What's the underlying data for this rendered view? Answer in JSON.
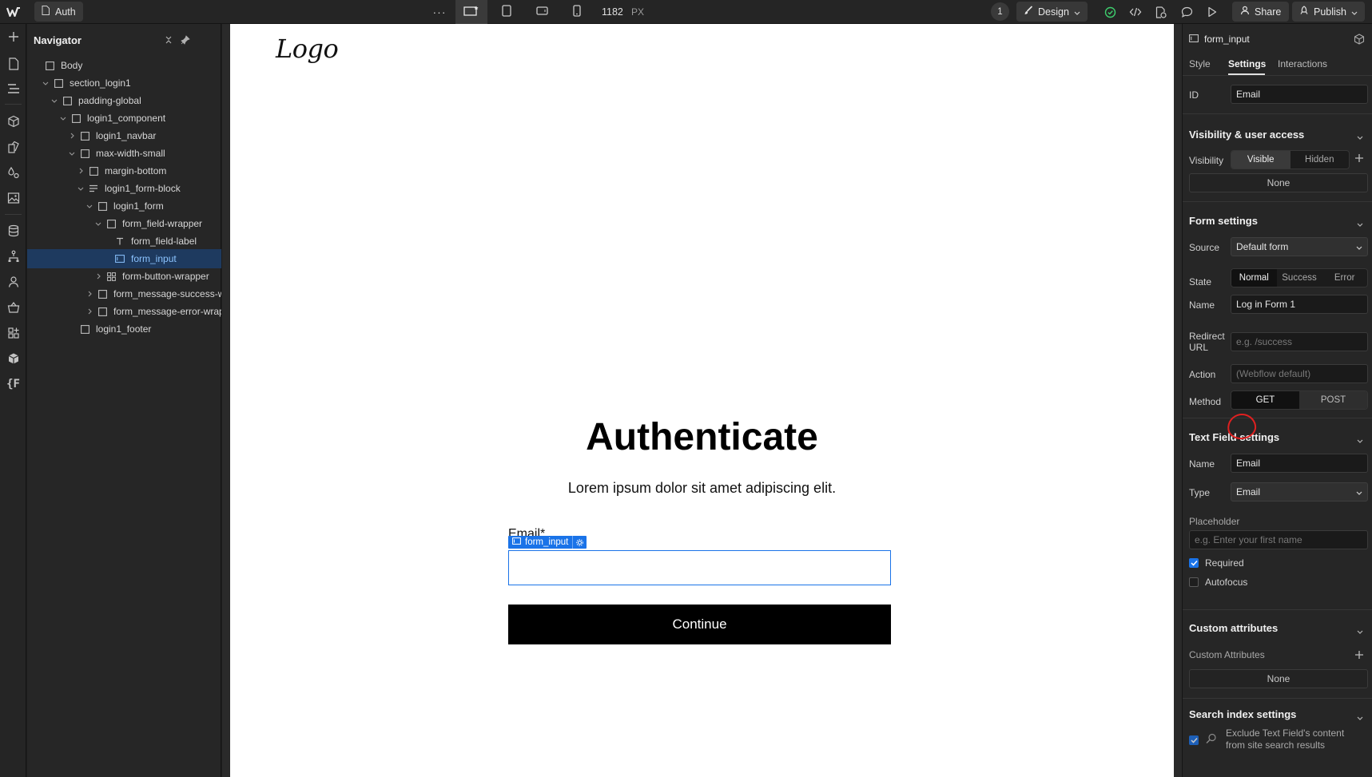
{
  "topbar": {
    "page_name": "Auth",
    "more_label": "···",
    "canvas_width": "1182",
    "canvas_unit": "PX",
    "badge_count": "1",
    "design_label": "Design",
    "share_label": "Share",
    "publish_label": "Publish"
  },
  "navigator": {
    "title": "Navigator",
    "tree": [
      {
        "label": "Body",
        "indent": 0,
        "caret": "none",
        "icon": "box"
      },
      {
        "label": "section_login1",
        "indent": 1,
        "caret": "open",
        "icon": "box"
      },
      {
        "label": "padding-global",
        "indent": 2,
        "caret": "open",
        "icon": "box"
      },
      {
        "label": "login1_component",
        "indent": 3,
        "caret": "open",
        "icon": "box"
      },
      {
        "label": "login1_navbar",
        "indent": 4,
        "caret": "closed",
        "icon": "box"
      },
      {
        "label": "max-width-small",
        "indent": 4,
        "caret": "open",
        "icon": "box"
      },
      {
        "label": "margin-bottom",
        "indent": 5,
        "caret": "closed",
        "icon": "box"
      },
      {
        "label": "login1_form-block",
        "indent": 5,
        "caret": "open",
        "icon": "lines"
      },
      {
        "label": "login1_form",
        "indent": 6,
        "caret": "open",
        "icon": "box"
      },
      {
        "label": "form_field-wrapper",
        "indent": 7,
        "caret": "open",
        "icon": "box"
      },
      {
        "label": "form_field-label",
        "indent": 8,
        "caret": "none",
        "icon": "text"
      },
      {
        "label": "form_input",
        "indent": 8,
        "caret": "none",
        "icon": "input",
        "selected": true
      },
      {
        "label": "form-button-wrapper",
        "indent": 7,
        "caret": "closed",
        "icon": "grid"
      },
      {
        "label": "form_message-success-wr",
        "indent": 6,
        "caret": "closed",
        "icon": "box"
      },
      {
        "label": "form_message-error-wrapp",
        "indent": 6,
        "caret": "closed",
        "icon": "box"
      },
      {
        "label": "login1_footer",
        "indent": 4,
        "caret": "none",
        "icon": "box"
      }
    ]
  },
  "canvas": {
    "logo_text": "Logo",
    "heading": "Authenticate",
    "subheading": "Lorem ipsum dolor sit amet adipiscing elit.",
    "field_label": "Email*",
    "selection_tag": "form_input",
    "button_label": "Continue"
  },
  "panel": {
    "element_name": "form_input",
    "tabs": [
      "Style",
      "Settings",
      "Interactions"
    ],
    "active_tab": "Settings",
    "id_label": "ID",
    "id_value": "Email",
    "visibility_section": "Visibility & user access",
    "visibility_label": "Visibility",
    "visibility_options": [
      "Visible",
      "Hidden"
    ],
    "visibility_none": "None",
    "form_section": "Form settings",
    "source_label": "Source",
    "source_value": "Default form",
    "state_label": "State",
    "state_options": [
      "Normal",
      "Success",
      "Error"
    ],
    "form_name_label": "Name",
    "form_name_value": "Log in Form 1",
    "redirect_label_1": "Redirect",
    "redirect_label_2": "URL",
    "redirect_placeholder": "e.g. /success",
    "action_label": "Action",
    "action_placeholder": "(Webflow default)",
    "method_label": "Method",
    "method_options": [
      "GET",
      "POST"
    ],
    "text_field_section": "Text Field settings",
    "tf_name_label": "Name",
    "tf_name_value": "Email",
    "type_label": "Type",
    "type_value": "Email",
    "placeholder_label": "Placeholder",
    "placeholder_placeholder": "e.g. Enter your first name",
    "required_label": "Required",
    "autofocus_label": "Autofocus",
    "custom_attr_section": "Custom attributes",
    "custom_attr_label": "Custom Attributes",
    "custom_attr_none": "None",
    "search_section": "Search index settings",
    "exclude_line_1": "Exclude Text Field's content",
    "exclude_line_2": "from site search results"
  },
  "colors": {
    "accent": "#1a73e8",
    "selected_row": "#1e3a5f",
    "annotation": "#e02020",
    "success": "#3ecf6e"
  }
}
